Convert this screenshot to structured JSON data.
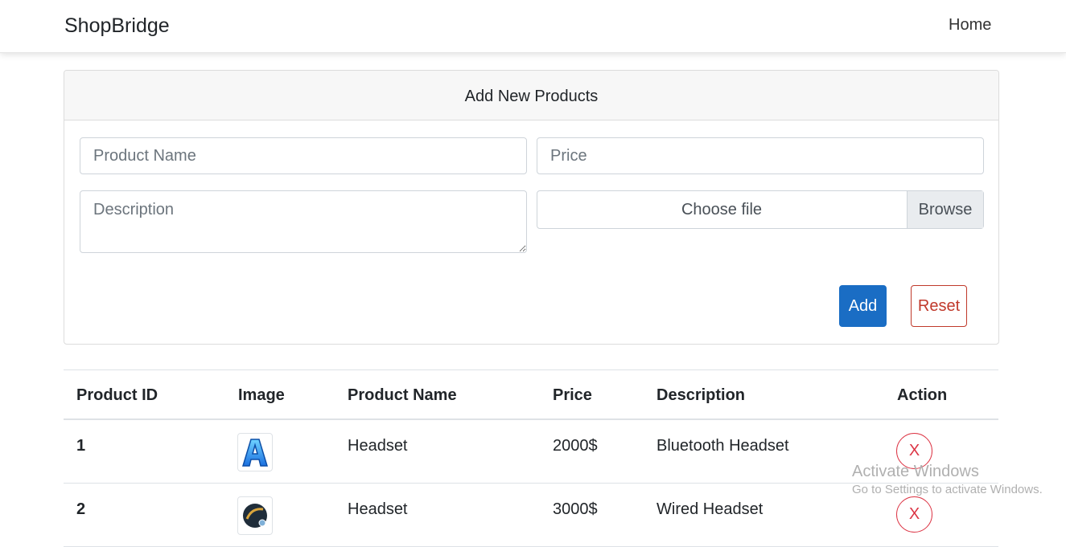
{
  "navbar": {
    "brand": "ShopBridge",
    "home_label": "Home"
  },
  "form": {
    "title": "Add New Products",
    "product_name_placeholder": "Product Name",
    "price_placeholder": "Price",
    "description_placeholder": "Description",
    "file_label": "Choose file",
    "browse_label": "Browse",
    "add_label": "Add",
    "reset_label": "Reset"
  },
  "table": {
    "headers": [
      "Product ID",
      "Image",
      "Product Name",
      "Price",
      "Description",
      "Action"
    ],
    "rows": [
      {
        "id": "1",
        "image_icon": "letter-a-app-icon",
        "name": "Headset",
        "price": "2000$",
        "description": "Bluetooth Headset",
        "action": "X"
      },
      {
        "id": "2",
        "image_icon": "dark-round-product-icon",
        "name": "Headset",
        "price": "3000$",
        "description": "Wired Headset",
        "action": "X"
      }
    ]
  },
  "watermark": {
    "title": "Activate Windows",
    "subtitle": "Go to Settings to activate Windows."
  },
  "colors": {
    "primary": "#1a6dc4",
    "danger": "#dc3545",
    "header_bg": "#f7f7f7"
  }
}
